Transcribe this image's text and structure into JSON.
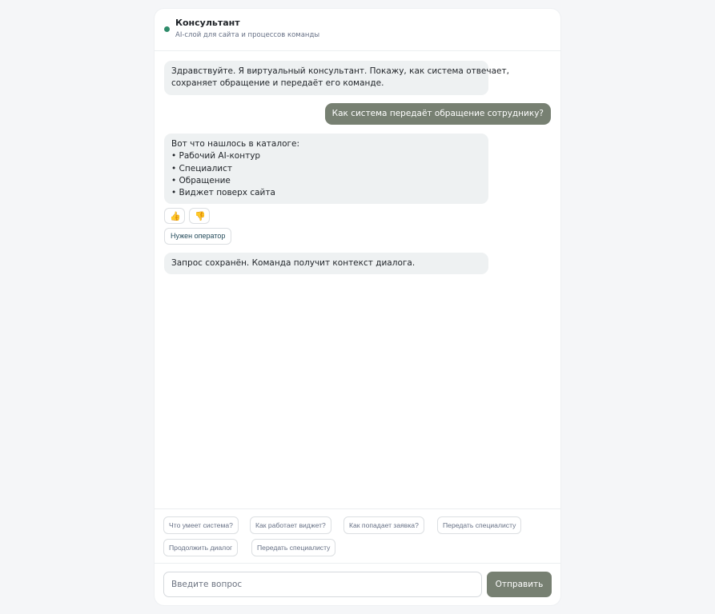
{
  "header": {
    "title": "Консультант",
    "subtitle": "AI-слой для сайта и процессов команды",
    "status_color": "#2e8b6a"
  },
  "messages": {
    "bot1": [
      "Здравствуйте. Я виртуальный консультант. Покажу, как система отвечает,",
      "сохраняет обращение и передаёт его команде."
    ],
    "user1": "Как система передаёт обращение сотруднику?",
    "bot2": [
      "Вот что нашлось в каталоге:",
      "• Рабочий AI-контур",
      "• Специалист",
      "• Обращение",
      "• Виджет поверх сайта"
    ],
    "bot3": "Запрос сохранён. Команда получит контекст диалога."
  },
  "feedback": {
    "like": "👍",
    "dislike": "👎",
    "operator_label": "Нужен оператор"
  },
  "quick_replies": [
    "Что умеет система?",
    "Как работает виджет?",
    "Как попадает заявка?",
    "Передать специалисту",
    "Продолжить диалог",
    "Передать специалисту"
  ],
  "composer": {
    "placeholder": "Введите вопрос",
    "send_label": "Отправить"
  },
  "colors": {
    "accent": "#778072",
    "bot_bubble": "#eef1f2",
    "background": "#f5f6f8"
  }
}
